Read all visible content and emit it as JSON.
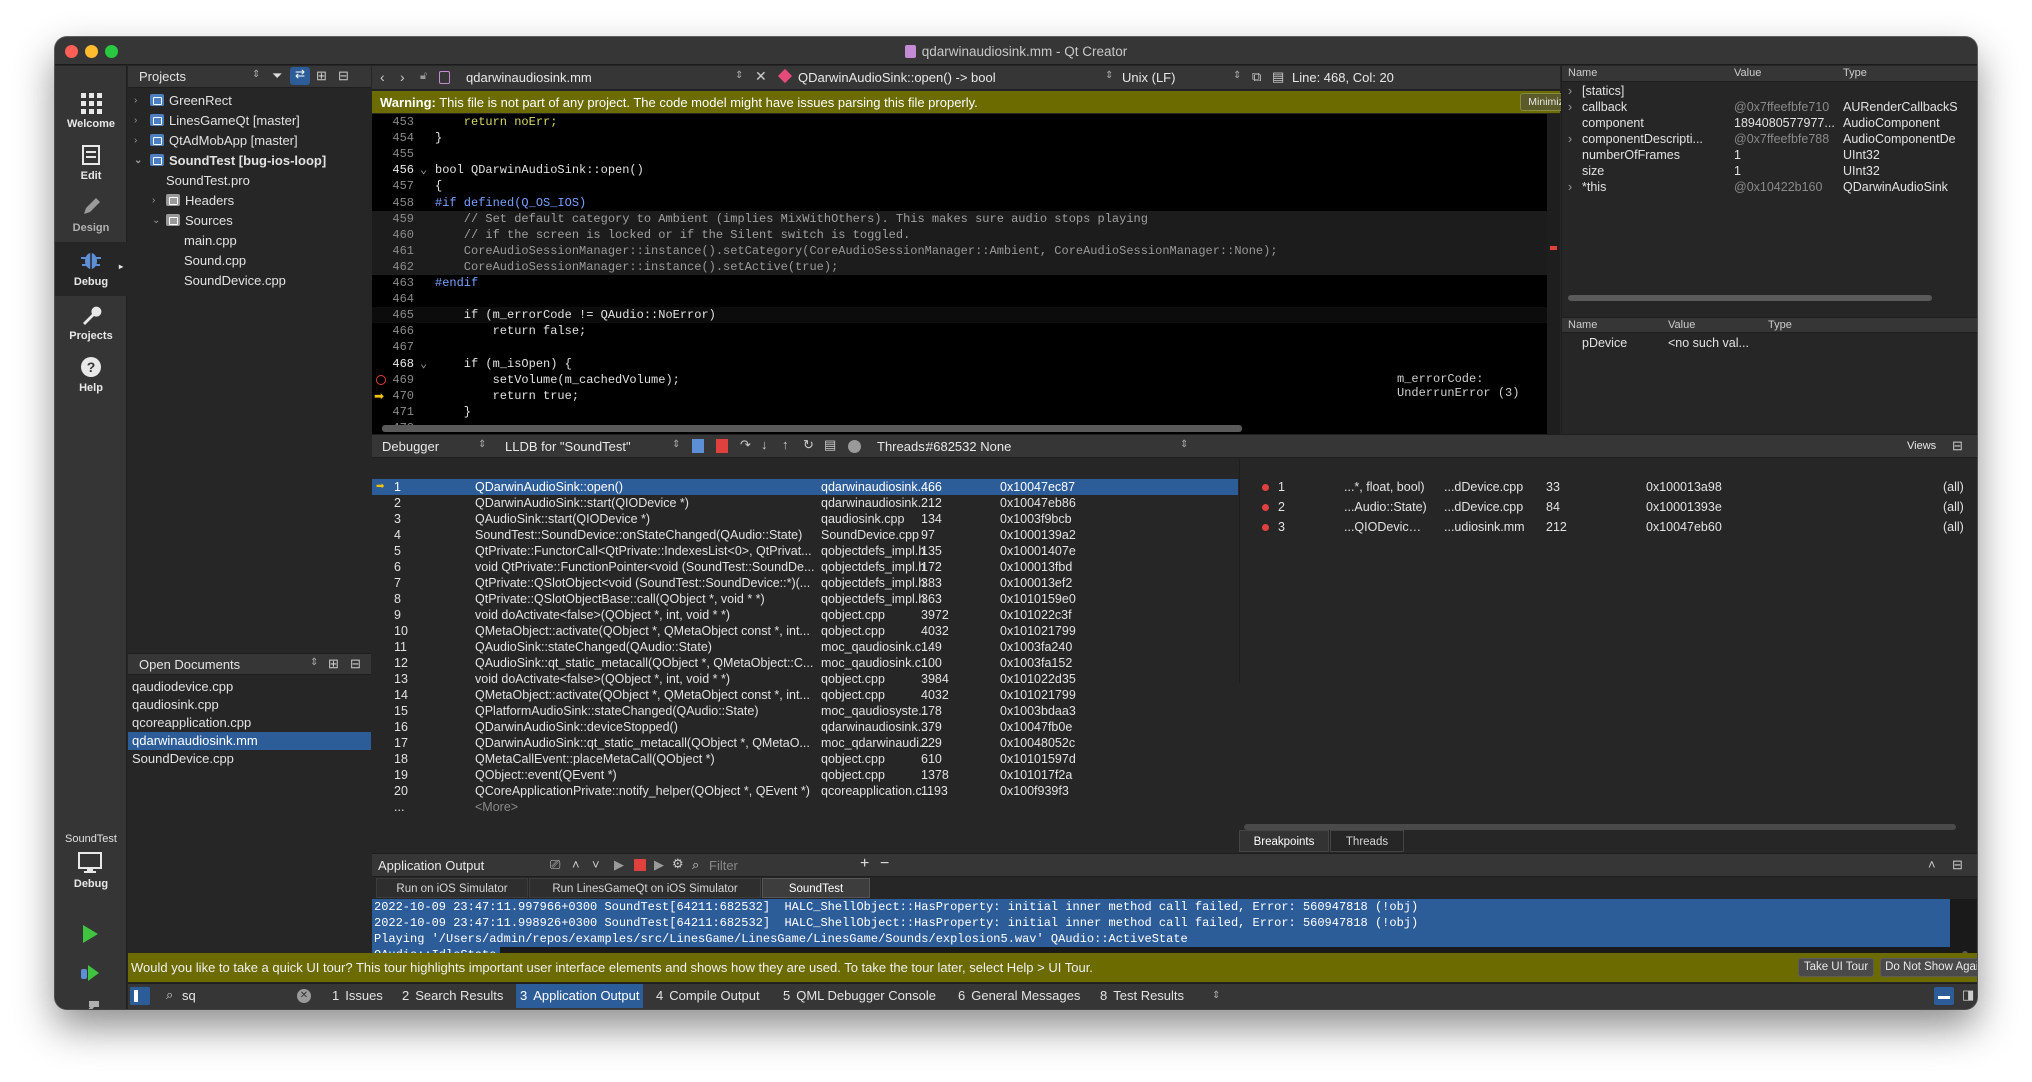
{
  "window": {
    "title": "qdarwinaudiosink.mm - Qt Creator"
  },
  "modes": [
    {
      "label": "Welcome",
      "icon": "grid-icon"
    },
    {
      "label": "Edit",
      "icon": "edit-icon"
    },
    {
      "label": "Design",
      "icon": "pencil-icon"
    },
    {
      "label": "Debug",
      "icon": "bug-icon"
    },
    {
      "label": "Projects",
      "icon": "wrench-icon"
    },
    {
      "label": "Help",
      "icon": "help-icon"
    }
  ],
  "kit": {
    "project": "SoundTest",
    "config": "Debug"
  },
  "projects_pane": {
    "title": "Projects",
    "items": [
      {
        "label": "GreenRect",
        "type": "project"
      },
      {
        "label": "LinesGameQt [master]",
        "type": "project"
      },
      {
        "label": "QtAdMobApp [master]",
        "type": "project"
      },
      {
        "label": "SoundTest [bug-ios-loop]",
        "type": "project"
      },
      {
        "label": "SoundTest.pro",
        "type": "file"
      },
      {
        "label": "Headers",
        "type": "folder"
      },
      {
        "label": "Sources",
        "type": "folder"
      },
      {
        "label": "main.cpp",
        "type": "file"
      },
      {
        "label": "Sound.cpp",
        "type": "file"
      },
      {
        "label": "SoundDevice.cpp",
        "type": "file"
      }
    ]
  },
  "open_documents": {
    "title": "Open Documents",
    "items": [
      "qaudiodevice.cpp",
      "qaudiosink.cpp",
      "qcoreapplication.cpp",
      "qdarwinaudiosink.mm",
      "SoundDevice.cpp"
    ],
    "selected": "qdarwinaudiosink.mm"
  },
  "editor": {
    "file": "qdarwinaudiosink.mm",
    "symbol": "QDarwinAudioSink::open() -> bool",
    "line_ending": "Unix (LF)",
    "position": "Line: 468, Col: 20",
    "warning_label": "Warning:",
    "warning_text": "This file is not part of any project. The code model might have issues parsing this file properly.",
    "minimize_label": "Minimize",
    "annotation": "m_errorCode: UnderrunError (3)",
    "lines": [
      {
        "n": "453",
        "t": "    return noErr;"
      },
      {
        "n": "454",
        "t": "}"
      },
      {
        "n": "455",
        "t": ""
      },
      {
        "n": "456",
        "t": "bool QDarwinAudioSink::open()"
      },
      {
        "n": "457",
        "t": "{"
      },
      {
        "n": "458",
        "t": "#if defined(Q_OS_IOS)"
      },
      {
        "n": "459",
        "t": "    // Set default category to Ambient (implies MixWithOthers). This makes sure audio stops playing"
      },
      {
        "n": "460",
        "t": "    // if the screen is locked or if the Silent switch is toggled."
      },
      {
        "n": "461",
        "t": "    CoreAudioSessionManager::instance().setCategory(CoreAudioSessionManager::Ambient, CoreAudioSessionManager::None);"
      },
      {
        "n": "462",
        "t": "    CoreAudioSessionManager::instance().setActive(true);"
      },
      {
        "n": "463",
        "t": "#endif"
      },
      {
        "n": "464",
        "t": ""
      },
      {
        "n": "465",
        "t": "    if (m_errorCode != QAudio::NoError)"
      },
      {
        "n": "466",
        "t": "        return false;"
      },
      {
        "n": "467",
        "t": ""
      },
      {
        "n": "468",
        "t": "    if (m_isOpen) {"
      },
      {
        "n": "469",
        "t": "        setVolume(m_cachedVolume);"
      },
      {
        "n": "470",
        "t": "        return true;"
      },
      {
        "n": "471",
        "t": "    }"
      },
      {
        "n": "472",
        "t": ""
      }
    ]
  },
  "locals": {
    "headers": [
      "Name",
      "Value",
      "Type"
    ],
    "rows": [
      {
        "name": "[statics]",
        "value": "",
        "type": "",
        "expand": true
      },
      {
        "name": "callback",
        "value": "@0x7ffeefbfe710",
        "type": "AURenderCallbackS",
        "expand": true
      },
      {
        "name": "component",
        "value": "1894080577977...",
        "type": "AudioComponent",
        "expand": false
      },
      {
        "name": "componentDescripti...",
        "value": "@0x7ffeefbfe788",
        "type": "AudioComponentDe",
        "expand": true
      },
      {
        "name": "numberOfFrames",
        "value": "1",
        "type": "UInt32",
        "expand": false
      },
      {
        "name": "size",
        "value": "1",
        "type": "UInt32",
        "expand": false
      },
      {
        "name": "*this",
        "value": "@0x10422b160",
        "type": "QDarwinAudioSink",
        "expand": true
      }
    ]
  },
  "expressions": {
    "headers": [
      "Name",
      "Value",
      "Type"
    ],
    "rows": [
      {
        "name": "pDevice",
        "value": "<no such val...",
        "type": ""
      }
    ]
  },
  "debugger_toolbar": {
    "engine": "Debugger",
    "target": "LLDB for \"SoundTest\"",
    "threads_label": "Threads:",
    "thread": "#682532 None",
    "views_label": "Views"
  },
  "stack": [
    {
      "level": "1",
      "fn": "QDarwinAudioSink::open()",
      "file": "qdarwinaudiosink....",
      "line": "466",
      "addr": "0x10047ec87"
    },
    {
      "level": "2",
      "fn": "QDarwinAudioSink::start(QIODevice *)",
      "file": "qdarwinaudiosink....",
      "line": "212",
      "addr": "0x10047eb86"
    },
    {
      "level": "3",
      "fn": "QAudioSink::start(QIODevice *)",
      "file": "qaudiosink.cpp",
      "line": "134",
      "addr": "0x1003f9bcb"
    },
    {
      "level": "4",
      "fn": "SoundTest::SoundDevice::onStateChanged(QAudio::State)",
      "file": "SoundDevice.cpp",
      "line": "97",
      "addr": "0x1000139a2"
    },
    {
      "level": "5",
      "fn": "QtPrivate::FunctorCall<QtPrivate::IndexesList<0>, QtPrivat...",
      "file": "qobjectdefs_impl.h",
      "line": "135",
      "addr": "0x10001407e"
    },
    {
      "level": "6",
      "fn": "void QtPrivate::FunctionPointer<void (SoundTest::SoundDe...",
      "file": "qobjectdefs_impl.h",
      "line": "172",
      "addr": "0x100013fbd"
    },
    {
      "level": "7",
      "fn": "QtPrivate::QSlotObject<void (SoundTest::SoundDevice::*)(...",
      "file": "qobjectdefs_impl.h",
      "line": "383",
      "addr": "0x100013ef2"
    },
    {
      "level": "8",
      "fn": "QtPrivate::QSlotObjectBase::call(QObject *, void * *)",
      "file": "qobjectdefs_impl.h",
      "line": "363",
      "addr": "0x1010159e0"
    },
    {
      "level": "9",
      "fn": "void doActivate<false>(QObject *, int, void * *)",
      "file": "qobject.cpp",
      "line": "3972",
      "addr": "0x101022c3f"
    },
    {
      "level": "10",
      "fn": "QMetaObject::activate(QObject *, QMetaObject const *, int...",
      "file": "qobject.cpp",
      "line": "4032",
      "addr": "0x101021799"
    },
    {
      "level": "11",
      "fn": "QAudioSink::stateChanged(QAudio::State)",
      "file": "moc_qaudiosink.c...",
      "line": "149",
      "addr": "0x1003fa240"
    },
    {
      "level": "12",
      "fn": "QAudioSink::qt_static_metacall(QObject *, QMetaObject::C...",
      "file": "moc_qaudiosink.c...",
      "line": "100",
      "addr": "0x1003fa152"
    },
    {
      "level": "13",
      "fn": "void doActivate<false>(QObject *, int, void * *)",
      "file": "qobject.cpp",
      "line": "3984",
      "addr": "0x101022d35"
    },
    {
      "level": "14",
      "fn": "QMetaObject::activate(QObject *, QMetaObject const *, int...",
      "file": "qobject.cpp",
      "line": "4032",
      "addr": "0x101021799"
    },
    {
      "level": "15",
      "fn": "QPlatformAudioSink::stateChanged(QAudio::State)",
      "file": "moc_qaudiosyste...",
      "line": "178",
      "addr": "0x1003bdaa3"
    },
    {
      "level": "16",
      "fn": "QDarwinAudioSink::deviceStopped()",
      "file": "qdarwinaudiosink....",
      "line": "379",
      "addr": "0x10047fb0e"
    },
    {
      "level": "17",
      "fn": "QDarwinAudioSink::qt_static_metacall(QObject *, QMetaO...",
      "file": "moc_qdarwinaudi...",
      "line": "229",
      "addr": "0x10048052c"
    },
    {
      "level": "18",
      "fn": "QMetaCallEvent::placeMetaCall(QObject *)",
      "file": "qobject.cpp",
      "line": "610",
      "addr": "0x10101597d"
    },
    {
      "level": "19",
      "fn": "QObject::event(QEvent *)",
      "file": "qobject.cpp",
      "line": "1378",
      "addr": "0x101017f2a"
    },
    {
      "level": "20",
      "fn": "QCoreApplicationPrivate::notify_helper(QObject *, QEvent *)",
      "file": "qcoreapplication.c...",
      "line": "1193",
      "addr": "0x100f939f3"
    },
    {
      "level": "...",
      "fn": "<More>",
      "file": "",
      "line": "",
      "addr": ""
    }
  ],
  "breakpoints": [
    {
      "num": "1",
      "fn": "...*, float, bool)",
      "file": "...dDevice.cpp",
      "line": "33",
      "addr": "0x100013a98",
      "cond": "(all)"
    },
    {
      "num": "2",
      "fn": "...Audio::State)",
      "file": "...dDevice.cpp",
      "line": "84",
      "addr": "0x10001393e",
      "cond": "(all)"
    },
    {
      "num": "3",
      "fn": "...QIODevice *)",
      "file": "...udiosink.mm",
      "line": "212",
      "addr": "0x10047eb60",
      "cond": "(all)"
    }
  ],
  "bp_tabs": [
    "Breakpoints",
    "Threads"
  ],
  "output": {
    "title": "Application Output",
    "filter_placeholder": "Filter",
    "tabs": [
      "Run on iOS Simulator",
      "Run LinesGameQt on iOS Simulator",
      "SoundTest"
    ],
    "lines": [
      "2022-10-09 23:47:11.997966+0300 SoundTest[64211:682532]  HALC_ShellObject::HasProperty: initial inner method call failed, Error: 560947818 (!obj)",
      "2022-10-09 23:47:11.998926+0300 SoundTest[64211:682532]  HALC_ShellObject::HasProperty: initial inner method call failed, Error: 560947818 (!obj)",
      "Playing '/Users/admin/repos/examples/src/LinesGame/LinesGame/LinesGame/Sounds/explosion5.wav' QAudio::ActiveState",
      "QAudio::IdleState"
    ]
  },
  "tour_bar": {
    "text": "Would you like to take a quick UI tour? This tour highlights important user interface elements and shows how they are used. To take the tour later, select Help > UI Tour.",
    "take_label": "Take UI Tour",
    "dismiss_label": "Do Not Show Again"
  },
  "statusbar": {
    "search_value": "sq",
    "tabs": [
      {
        "num": "1",
        "label": "Issues"
      },
      {
        "num": "2",
        "label": "Search Results"
      },
      {
        "num": "3",
        "label": "Application Output"
      },
      {
        "num": "4",
        "label": "Compile Output"
      },
      {
        "num": "5",
        "label": "QML Debugger Console"
      },
      {
        "num": "6",
        "label": "General Messages"
      },
      {
        "num": "8",
        "label": "Test Results"
      }
    ]
  },
  "colors": {
    "selection": "#2d5d99",
    "warning_bar": "#6b6b00",
    "breakpoint": "#e0413f",
    "comment": "#a0a0a0",
    "keyword": "#d8d86a"
  }
}
